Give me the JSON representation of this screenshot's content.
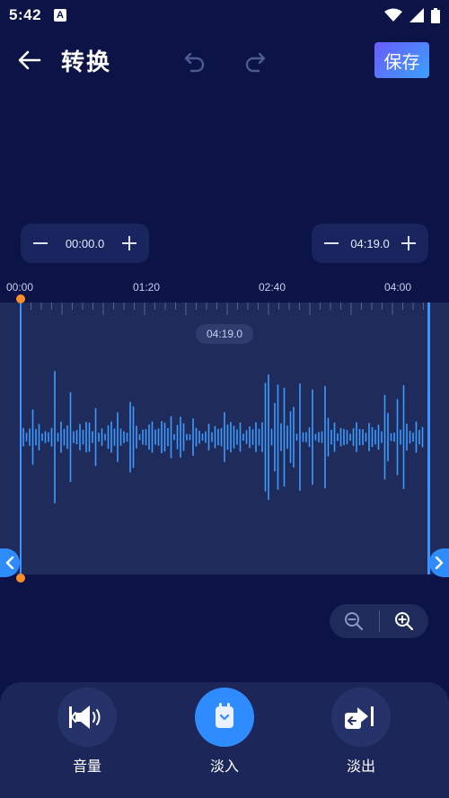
{
  "status_bar": {
    "time": "5:42",
    "notification_glyph": "A"
  },
  "toolbar": {
    "title": "转换",
    "save_label": "保存"
  },
  "range": {
    "start": "00:00.0",
    "end": "04:19.0"
  },
  "ruler": {
    "labels": [
      "00:00",
      "01:20",
      "02:40",
      "04:00"
    ]
  },
  "waveform": {
    "duration": "04:19.0"
  },
  "tools": [
    {
      "label": "音量",
      "icon": "volume-icon"
    },
    {
      "label": "淡入",
      "icon": "fade-in-icon",
      "active": true
    },
    {
      "label": "淡出",
      "icon": "fade-out-icon"
    }
  ],
  "colors": {
    "background": "#0b1347",
    "accent": "#2f8cff",
    "waveform": "#3c9bff",
    "marker": "#ff8c2a",
    "save_gradient_start": "#6a5bff",
    "save_gradient_end": "#3aa0ff"
  }
}
